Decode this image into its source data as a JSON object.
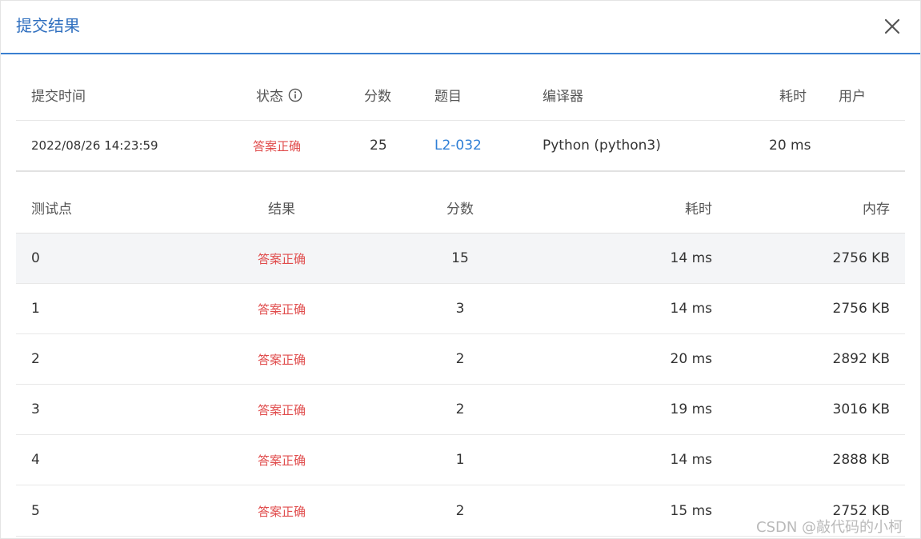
{
  "dialog": {
    "title": "提交结果",
    "close_icon": "close-icon"
  },
  "submission": {
    "headers": {
      "time": "提交时间",
      "status": "状态",
      "score": "分数",
      "problem": "题目",
      "compiler": "编译器",
      "elapsed": "耗时",
      "user": "用户"
    },
    "status_info_icon": "info-circle-icon",
    "row": {
      "time": "2022/08/26 14:23:59",
      "status": "答案正确",
      "score": "25",
      "problem": "L2-032",
      "compiler": "Python (python3)",
      "elapsed": "20 ms",
      "user": ""
    }
  },
  "tests": {
    "headers": {
      "case": "测试点",
      "result": "结果",
      "score": "分数",
      "elapsed": "耗时",
      "memory": "内存"
    },
    "rows": [
      {
        "case": "0",
        "result": "答案正确",
        "score": "15",
        "elapsed": "14 ms",
        "memory": "2756 KB"
      },
      {
        "case": "1",
        "result": "答案正确",
        "score": "3",
        "elapsed": "14 ms",
        "memory": "2756 KB"
      },
      {
        "case": "2",
        "result": "答案正确",
        "score": "2",
        "elapsed": "20 ms",
        "memory": "2892 KB"
      },
      {
        "case": "3",
        "result": "答案正确",
        "score": "2",
        "elapsed": "19 ms",
        "memory": "3016 KB"
      },
      {
        "case": "4",
        "result": "答案正确",
        "score": "1",
        "elapsed": "14 ms",
        "memory": "2888 KB"
      },
      {
        "case": "5",
        "result": "答案正确",
        "score": "2",
        "elapsed": "15 ms",
        "memory": "2752 KB"
      }
    ]
  },
  "watermark": "CSDN @敲代码的小柯",
  "colors": {
    "title": "#2f6fbf",
    "accent_line": "#3b7fd1",
    "accepted": "#e04b4b",
    "link": "#2f7fd6",
    "alt_row": "#f4f5f7"
  }
}
